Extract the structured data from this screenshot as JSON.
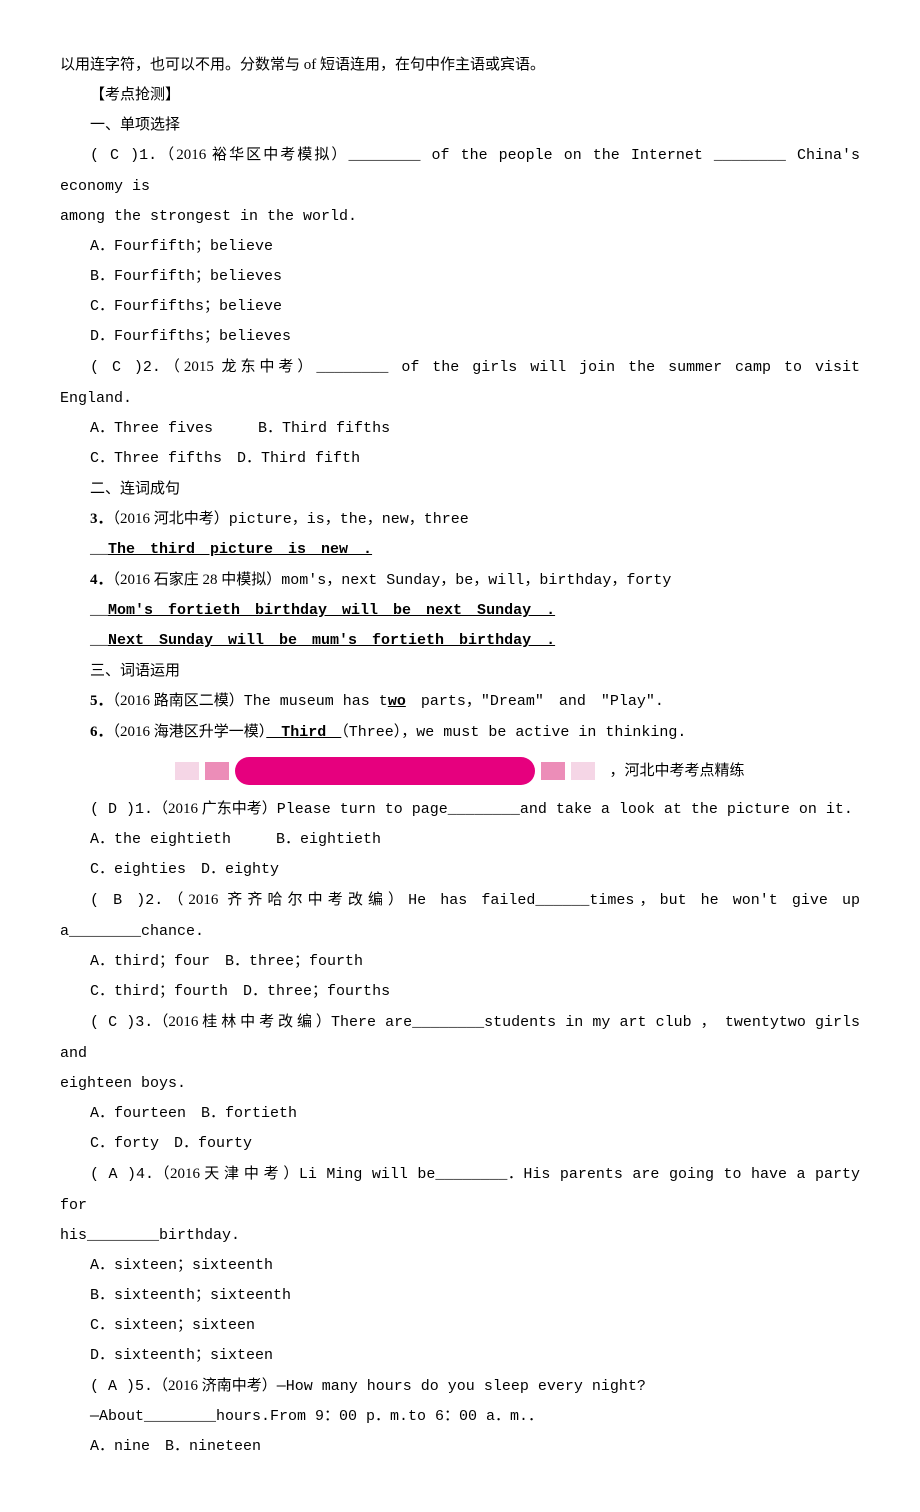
{
  "intro": "以用连字符，也可以不用。分数常与 of 短语连用，在句中作主语或宾语。",
  "sectionHeaders": {
    "detect": "【考点抢测】",
    "part1": "一、单项选择",
    "part2": "二、连词成句",
    "part3": "三、词语运用",
    "bannerCaption": "，河北中考考点精练"
  },
  "q1": {
    "num": "( C )1.",
    "src": "（2016 裕华区中考模拟）",
    "stem1": "________ of the people on the Internet ________ China's economy is",
    "stem2": "among the strongest in the world.",
    "A": "A．Fourfifth；believe",
    "B": "B．Fourfifth；believes",
    "C": "C．Fourfifths；believe",
    "D": "D．Fourfifths；believes"
  },
  "q2": {
    "num": "( C )2.",
    "src": "（2015 龙东中考）",
    "stem": "________ of the girls will join the summer camp to visit England.",
    "A": "A．Three fives",
    "B": "B．Third fifths",
    "C": "C．Three fifths",
    "D": "D．Third fifth"
  },
  "q3": {
    "num": "3．",
    "src": "（2016 河北中考）",
    "stem": "picture，is，the，new，three",
    "ans": "The　third　picture　is　new　."
  },
  "q4": {
    "num": "4．",
    "src": "（2016 石家庄 28 中模拟）",
    "stem": "mom's，next Sunday，be，will，birthday，forty",
    "ans1": "Mom's　fortieth　birthday　will　be　next　Sunday　.",
    "ans2": "Next　Sunday　will　be　mum's　fortieth　birthday　."
  },
  "q5": {
    "num": "5．",
    "src": "（2016 路南区二模）",
    "stemPre": "The museum has t",
    "ans": "wo",
    "stemPost": "　parts，\"Dream\"　and　\"Play\"."
  },
  "q6": {
    "num": "6．",
    "src": "（2016 海港区升学一模）",
    "ans": "　Third　",
    "stemPost": "（Three），we must be active in thinking."
  },
  "p1": {
    "num": "( D )1.",
    "src": "（2016 广东中考）",
    "stem": "Please turn to page________and take a look at the picture on it.",
    "A": "A．the eightieth",
    "B": "B．eightieth",
    "C": "C．eighties",
    "D": "D．eighty"
  },
  "p2": {
    "num": "( B )2.",
    "src": "（2016 齐齐哈尔中考改编）",
    "stem": "He has failed______times，but he won't give up a________chance.",
    "A": "A．third；four",
    "B": "B．three；fourth",
    "C": "C．third；fourth",
    "D": "D．three；fourths"
  },
  "p3": {
    "num": "( C )3.",
    "src": "（2016 桂 林 中 考 改 编 ）",
    "stem1": "There are________students in my art club ， twentytwo girls and",
    "stem2": "eighteen boys.",
    "A": "A．fourteen",
    "B": "B．fortieth",
    "C": "C．forty",
    "D": "D．fourty"
  },
  "p4": {
    "num": "( A )4.",
    "src": "（2016 天 津 中 考 ）",
    "stem1": "Li Ming will be________．His parents are going to have a party for",
    "stem2": "his________birthday.",
    "A": "A．sixteen；sixteenth",
    "B": "B．sixteenth；sixteenth",
    "C": "C．sixteen；sixteen",
    "D": "D．sixteenth；sixteen"
  },
  "p5": {
    "num": "( A )5.",
    "src": "（2016 济南中考）",
    "stem1": "—How many hours do you sleep every night?",
    "stem2": "—About________hours.From 9：00 p．m.to 6：00 a．m.．",
    "A": "A．nine",
    "B": "B．nineteen"
  }
}
